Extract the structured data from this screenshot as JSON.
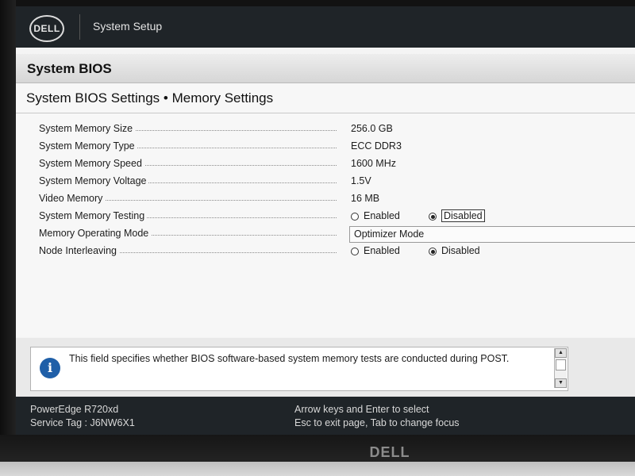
{
  "app": {
    "logo_text": "DELL",
    "title": "System Setup"
  },
  "section_title": "System BIOS",
  "page_title": "System BIOS Settings • Memory Settings",
  "settings": {
    "memory_size": {
      "label": "System Memory Size",
      "value": "256.0 GB"
    },
    "memory_type": {
      "label": "System Memory Type",
      "value": "ECC DDR3"
    },
    "memory_speed": {
      "label": "System Memory Speed",
      "value": "1600 MHz"
    },
    "memory_voltage": {
      "label": "System Memory Voltage",
      "value": "1.5V"
    },
    "video_memory": {
      "label": "Video Memory",
      "value": "16 MB"
    },
    "memory_testing": {
      "label": "System Memory Testing",
      "options": [
        "Enabled",
        "Disabled"
      ],
      "selected": "Disabled"
    },
    "operating_mode": {
      "label": "Memory Operating Mode",
      "value": "Optimizer Mode"
    },
    "node_interleaving": {
      "label": "Node Interleaving",
      "options": [
        "Enabled",
        "Disabled"
      ],
      "selected": "Disabled"
    }
  },
  "help": {
    "icon": "info-icon",
    "text": "This field specifies whether BIOS software-based system memory tests are conducted during POST."
  },
  "status": {
    "model": "PowerEdge R720xd",
    "service_tag": "Service Tag : J6NW6X1",
    "hint_line1": "Arrow keys and Enter to select",
    "hint_line2": "Esc to exit page, Tab to change focus"
  },
  "monitor": {
    "brand": "DELL"
  },
  "colors": {
    "header_bg": "#1f2428",
    "info_icon": "#1f5fa8",
    "page_bg": "#f7f7f7"
  }
}
